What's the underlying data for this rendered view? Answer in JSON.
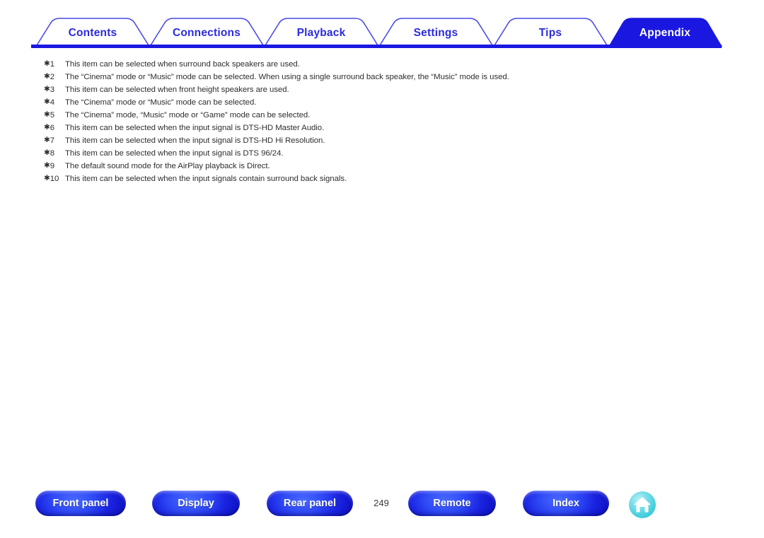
{
  "tabs": [
    {
      "label": "Contents",
      "active": false
    },
    {
      "label": "Connections",
      "active": false
    },
    {
      "label": "Playback",
      "active": false
    },
    {
      "label": "Settings",
      "active": false
    },
    {
      "label": "Tips",
      "active": false
    },
    {
      "label": "Appendix",
      "active": true
    }
  ],
  "notes": [
    {
      "mark": "1",
      "text": "This item can be selected when surround back speakers are used."
    },
    {
      "mark": "2",
      "text": "The “Cinema” mode or “Music” mode can be selected. When using a single surround back speaker, the “Music” mode is used."
    },
    {
      "mark": "3",
      "text": "This item can be selected when front height speakers are used."
    },
    {
      "mark": "4",
      "text": "The “Cinema” mode or “Music” mode can be selected."
    },
    {
      "mark": "5",
      "text": "The “Cinema” mode, “Music” mode or “Game” mode can be selected."
    },
    {
      "mark": "6",
      "text": "This item can be selected when the input signal is DTS-HD Master Audio."
    },
    {
      "mark": "7",
      "text": "This item can be selected when the input signal is DTS-HD Hi Resolution."
    },
    {
      "mark": "8",
      "text": "This item can be selected when the input signal is DTS 96/24."
    },
    {
      "mark": "9",
      "text": "The default sound mode for the AirPlay playback is Direct."
    },
    {
      "mark": "10",
      "text": "This item can be selected when the input signals contain surround back signals."
    }
  ],
  "footer": {
    "front_panel": "Front panel",
    "display": "Display",
    "rear_panel": "Rear panel",
    "page_number": "249",
    "remote": "Remote",
    "index": "Index",
    "home_icon": "home-icon"
  },
  "colors": {
    "tab_blue": "#2b2bdc",
    "active_tab_fill": "#1a18e0",
    "rule_blue": "#1a18e0",
    "button_blue": "#2d47f5",
    "home_teal": "#4fd6e0",
    "text_gray": "#2e2e2e"
  }
}
